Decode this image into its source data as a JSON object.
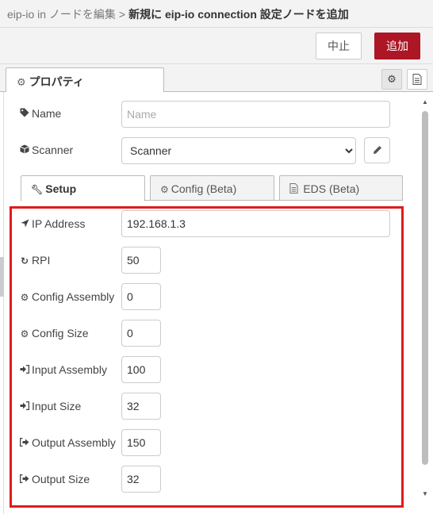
{
  "breadcrumb": {
    "parent": "eip-io in ノードを編集",
    "separator": ">",
    "current": "新規に eip-io connection 設定ノードを追加"
  },
  "actions": {
    "cancel": "中止",
    "add": "追加"
  },
  "tabs": {
    "properties": "プロパティ"
  },
  "form": {
    "name": {
      "label": "Name",
      "placeholder": "Name",
      "value": ""
    },
    "scanner": {
      "label": "Scanner",
      "value": "Scanner",
      "options": [
        "Scanner"
      ]
    }
  },
  "subtabs": {
    "setup": "Setup",
    "config": "Config (Beta)",
    "eds": "EDS (Beta)"
  },
  "setup": {
    "ip_address": {
      "label": "IP Address",
      "value": "192.168.1.3"
    },
    "rpi": {
      "label": "RPI",
      "value": "50"
    },
    "config_assembly": {
      "label": "Config Assembly",
      "value": "0"
    },
    "config_size": {
      "label": "Config Size",
      "value": "0"
    },
    "input_assembly": {
      "label": "Input Assembly",
      "value": "100"
    },
    "input_size": {
      "label": "Input Size",
      "value": "32"
    },
    "output_assembly": {
      "label": "Output Assembly",
      "value": "150"
    },
    "output_size": {
      "label": "Output Size",
      "value": "32"
    }
  },
  "icons": {
    "properties_tab": "gear-icon",
    "name": "tag-icon",
    "scanner": "cube-icon",
    "edit": "pencil-icon",
    "setup": "wrench-icon",
    "config": "gears-icon",
    "eds": "document-icon",
    "ip_address": "location-arrow-icon",
    "rpi": "refresh-icon",
    "config_assembly": "gear-icon",
    "config_size": "gear-icon",
    "input_assembly": "sign-in-icon",
    "input_size": "sign-in-icon",
    "output_assembly": "sign-out-icon",
    "output_size": "sign-out-icon"
  },
  "colors": {
    "primary_button": "#ad1625",
    "highlight_border": "#e21a1a"
  }
}
